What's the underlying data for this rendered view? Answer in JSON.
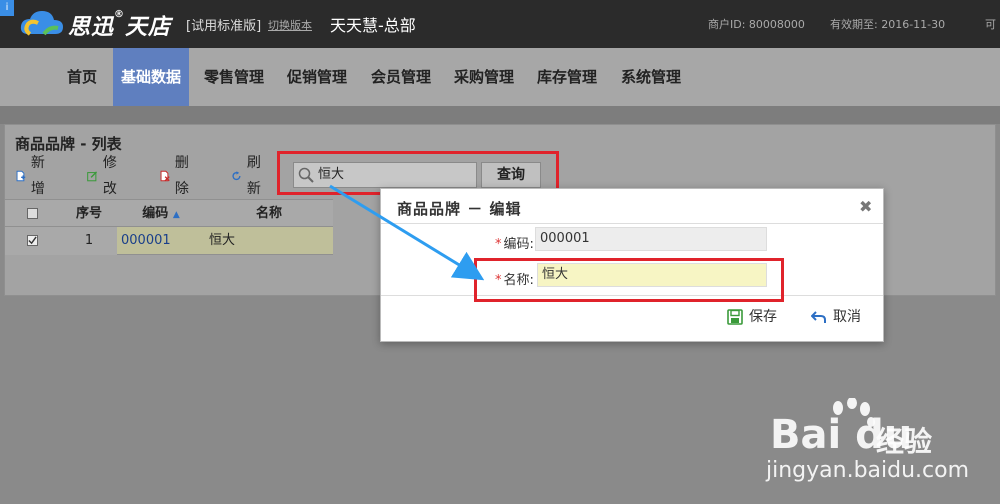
{
  "header": {
    "corner_tab": "i",
    "brand": "思迅",
    "brand_suffix": "天店",
    "edition": "[试用标准版]",
    "switch_link": "切换版本",
    "store_name": "天天慧-总部",
    "merchant_id": "商户ID: 80008000",
    "expiry": "有效期至: 2016-11-30",
    "cut_text": "可"
  },
  "nav": {
    "items": [
      {
        "label": "首页",
        "active": false
      },
      {
        "label": "基础数据",
        "active": true
      },
      {
        "label": "零售管理",
        "active": false
      },
      {
        "label": "促销管理",
        "active": false
      },
      {
        "label": "会员管理",
        "active": false
      },
      {
        "label": "采购管理",
        "active": false
      },
      {
        "label": "库存管理",
        "active": false
      },
      {
        "label": "系统管理",
        "active": false
      }
    ]
  },
  "list_panel": {
    "title": "商品品牌 - 列表",
    "toolbar": {
      "add": "新增",
      "edit": "修改",
      "delete": "删除",
      "refresh": "刷新"
    },
    "search": {
      "value": "恒大"
    },
    "query_button": "查询",
    "table": {
      "columns": [
        "序号",
        "编码",
        "名称"
      ],
      "rows": [
        {
          "index": "1",
          "code": "000001",
          "name": "恒大",
          "checked": true
        }
      ]
    }
  },
  "dialog": {
    "title": "商品品牌 － 编辑",
    "close_symbol": "✖",
    "fields": {
      "code_label": "编码:",
      "code_value": "000001",
      "name_label": "名称:",
      "name_value": "恒大"
    },
    "save": "保存",
    "cancel": "取消"
  },
  "watermark": {
    "brand": "Bai du",
    "sub": "经验",
    "url": "jingyan.baidu.com"
  },
  "colors": {
    "header_bg": "#2b2b2b",
    "nav_active": "#5f7fbf",
    "highlight_red": "#e0232b",
    "arrow_blue": "#2e9df0",
    "name_field_bg": "#f7f5c4"
  }
}
